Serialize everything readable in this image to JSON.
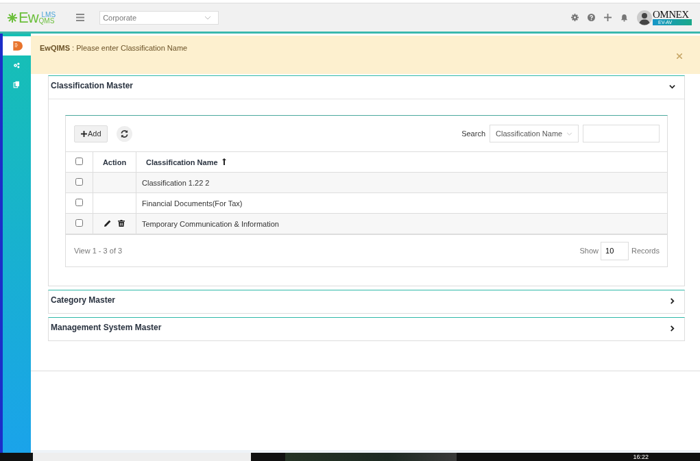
{
  "header": {
    "logo": {
      "main": "Ew",
      "top": "LMS",
      "bottom": "QMS"
    },
    "site_select": {
      "value": "Corporate"
    },
    "brand": {
      "name": "OMNEX",
      "tag": "EV-AV"
    }
  },
  "sidebar": {
    "items": [
      {
        "kind": "document",
        "selected": true
      },
      {
        "kind": "gears",
        "selected": false
      },
      {
        "kind": "copy",
        "selected": false
      }
    ]
  },
  "alert": {
    "message": "**EwQIMS** : Please enter Classification Name"
  },
  "panels": [
    {
      "title": "Classification Master",
      "expanded": true,
      "grid": {
        "add_label": "Add",
        "search_label": "Search",
        "search_by": "Classification Name",
        "columns": [
          "Action",
          "Classification Name"
        ],
        "all_checked": false,
        "rows": [
          {
            "name": "Classification 1.22 2",
            "checked": false,
            "actions": false
          },
          {
            "name": "Financial Documents(For Tax)",
            "checked": false,
            "actions": false
          },
          {
            "name": "Temporary Communication & Information",
            "checked": false,
            "actions": true
          }
        ],
        "footer": {
          "view": "View 1 - 3 of 3",
          "show_label": "Show",
          "page_size": "10",
          "records_label": "Records"
        }
      }
    },
    {
      "title": "Category Master",
      "expanded": false
    },
    {
      "title": "Management System Master",
      "expanded": false
    }
  ],
  "taskbar": {
    "clock": "16:22"
  }
}
